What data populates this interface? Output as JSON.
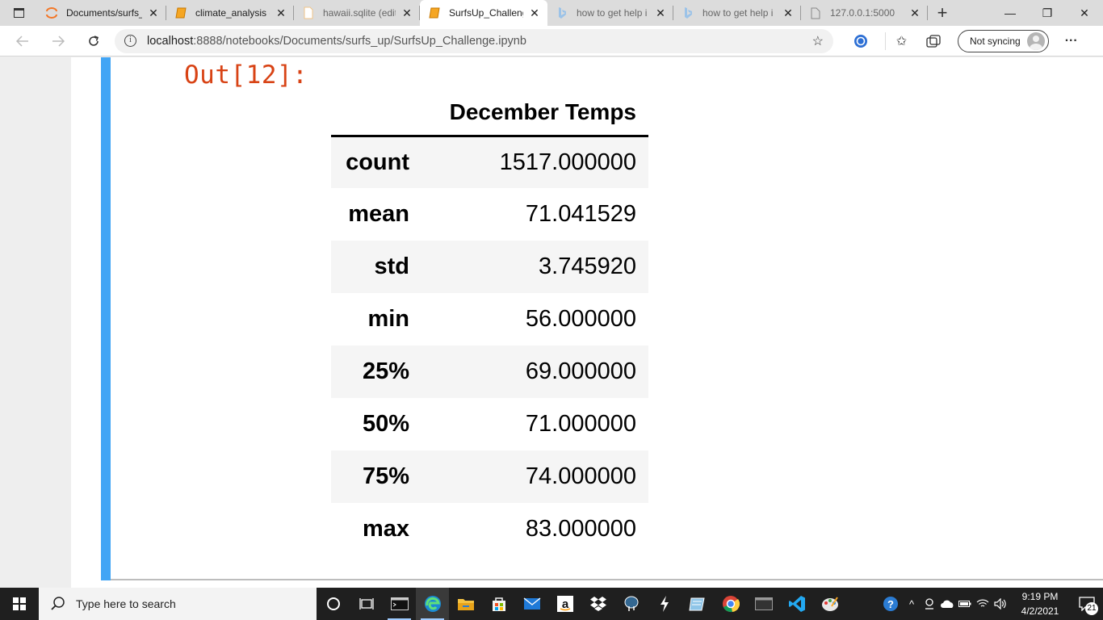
{
  "browser": {
    "tabs": [
      {
        "label": "Documents/surfs_",
        "icon": "jupyter-icon",
        "active": false,
        "faded": false
      },
      {
        "label": "climate_analysis - ",
        "icon": "notebook-icon",
        "active": false,
        "faded": false
      },
      {
        "label": "hawaii.sqlite (edit",
        "icon": "file-icon",
        "active": false,
        "faded": true
      },
      {
        "label": "SurfsUp_Challeng",
        "icon": "notebook-icon",
        "active": true,
        "faded": false
      },
      {
        "label": "how to get help i",
        "icon": "bing-icon",
        "active": false,
        "faded": true
      },
      {
        "label": "how to get help i",
        "icon": "bing-icon",
        "active": false,
        "faded": true
      },
      {
        "label": "127.0.0.1:5000",
        "icon": "page-icon",
        "active": false,
        "faded": true
      }
    ],
    "close_glyph": "✕",
    "new_tab_glyph": "+",
    "window_controls": {
      "minimize": "—",
      "restore": "❐",
      "close": "✕"
    },
    "address": {
      "host": "localhost",
      "path": ":8888/notebooks/Documents/surfs_up/SurfsUp_Challenge.ipynb"
    },
    "sync_label": "Not syncing",
    "more_glyph": "···"
  },
  "notebook": {
    "out_prompt": "Out[12]:",
    "table": {
      "column": "December Temps",
      "rows": [
        {
          "index": "count",
          "value": "1517.000000"
        },
        {
          "index": "mean",
          "value": "71.041529"
        },
        {
          "index": "std",
          "value": "3.745920"
        },
        {
          "index": "min",
          "value": "56.000000"
        },
        {
          "index": "25%",
          "value": "69.000000"
        },
        {
          "index": "50%",
          "value": "71.000000"
        },
        {
          "index": "75%",
          "value": "74.000000"
        },
        {
          "index": "max",
          "value": "83.000000"
        }
      ]
    }
  },
  "taskbar": {
    "search_placeholder": "Type here to search",
    "clock_time": "9:19 PM",
    "clock_date": "4/2/2021",
    "notification_count": "21",
    "colors": {
      "accent": "#42a5f5",
      "out_prompt": "#d84315",
      "taskbar": "#1f1f1f"
    }
  }
}
